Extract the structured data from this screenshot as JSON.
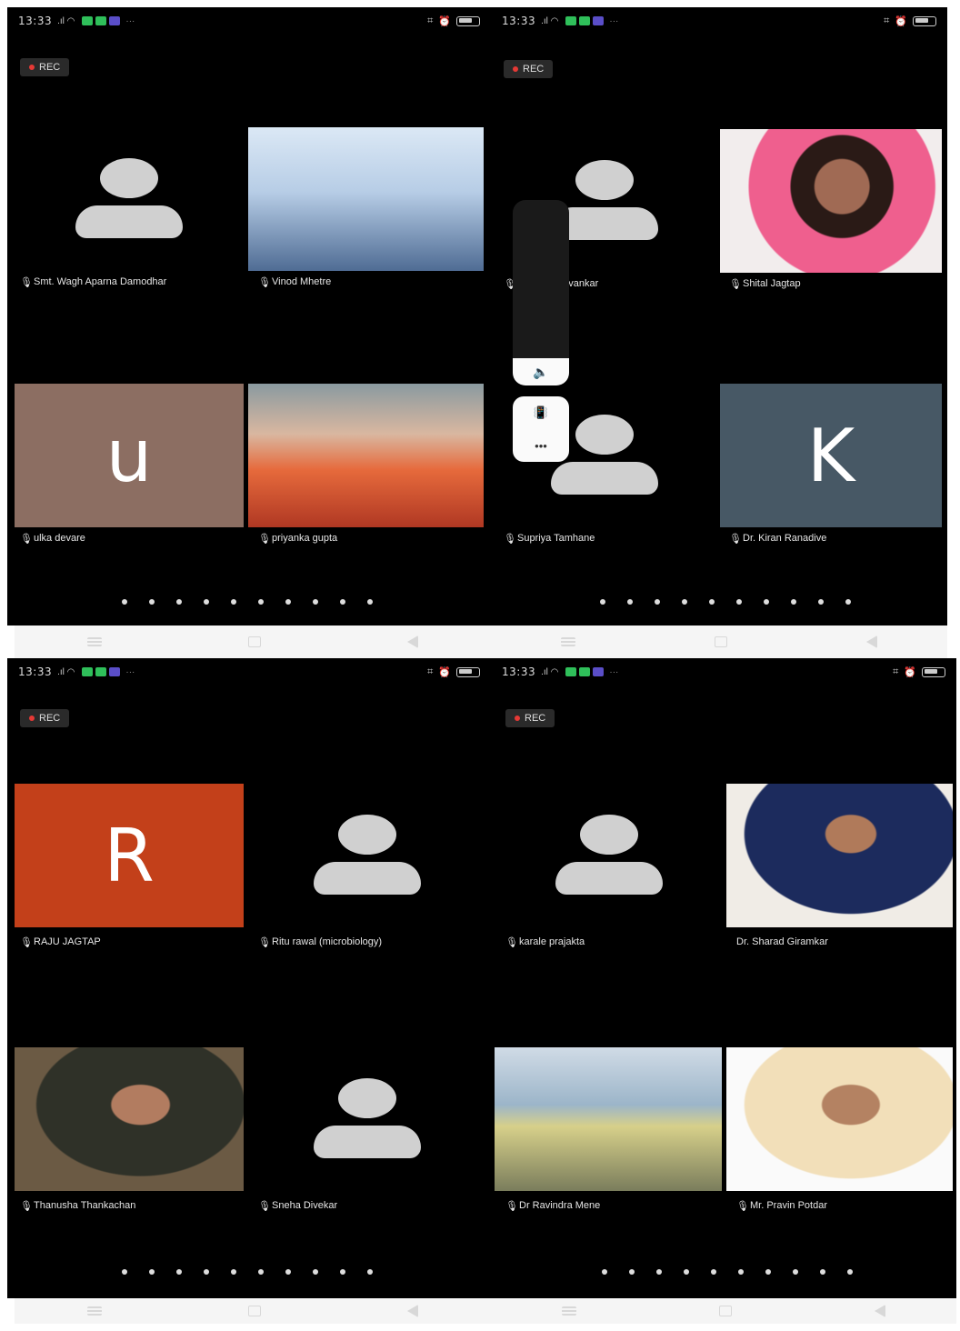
{
  "status": {
    "time": "13:33",
    "battery": "80"
  },
  "rec_label": "REC",
  "colors": {
    "tile_u": "#8c6e62",
    "tile_k": "#475865",
    "tile_r": "#c3401a"
  },
  "screens": [
    {
      "participants": [
        {
          "name": "Smt. Wagh Aparna Damodhar",
          "type": "generic"
        },
        {
          "name": "Vinod Mhetre",
          "type": "photo",
          "photo": "penguins"
        },
        {
          "name": "ulka devare",
          "type": "letter",
          "letter": "u"
        },
        {
          "name": "priyanka gupta",
          "type": "photo",
          "photo": "ganesh"
        }
      ]
    },
    {
      "participants": [
        {
          "name": "mahima shivankar",
          "type": "generic"
        },
        {
          "name": "Shital Jagtap",
          "type": "photo",
          "photo": "woman"
        },
        {
          "name": "Supriya Tamhane",
          "type": "generic"
        },
        {
          "name": "Dr. Kiran Ranadive",
          "type": "letter",
          "letter": "K"
        }
      ],
      "volume_panel": {
        "speaker_icon": "speaker-icon",
        "vibrate_icon": "vibrate-icon",
        "more_icon": "more-icon",
        "more_label": "•••"
      }
    },
    {
      "participants": [
        {
          "name": "RAJU JAGTAP",
          "type": "letter",
          "letter": "R"
        },
        {
          "name": "Ritu rawal (microbiology)",
          "type": "generic"
        },
        {
          "name": "Thanusha Thankachan",
          "type": "photo",
          "photo": "girl"
        },
        {
          "name": "Sneha Divekar",
          "type": "generic"
        }
      ]
    },
    {
      "participants": [
        {
          "name": "karale prajakta",
          "type": "generic"
        },
        {
          "name": "Dr. Sharad Giramkar",
          "type": "photo",
          "photo": "man"
        },
        {
          "name": "Dr Ravindra Mene",
          "type": "photo",
          "photo": "child"
        },
        {
          "name": "Mr. Pravin Potdar",
          "type": "photo",
          "photo": "man2"
        }
      ]
    }
  ]
}
